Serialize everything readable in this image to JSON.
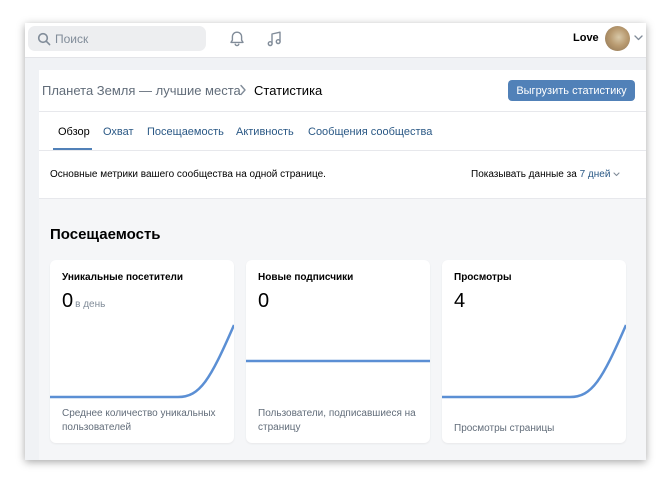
{
  "topbar": {
    "search_placeholder": "Поиск",
    "user_name": "Love"
  },
  "breadcrumb": {
    "community": "Планета Земля — лучшие места",
    "current": "Статистика"
  },
  "export_button": "Выгрузить статистику",
  "tabs": [
    {
      "label": "Обзор",
      "active": true
    },
    {
      "label": "Охват",
      "active": false
    },
    {
      "label": "Посещаемость",
      "active": false
    },
    {
      "label": "Активность",
      "active": false
    },
    {
      "label": "Сообщения сообщества",
      "active": false
    }
  ],
  "info": {
    "description": "Основные метрики вашего сообщества на одной странице.",
    "period_label": "Показывать данные за",
    "period_value": "7 дней"
  },
  "section": {
    "title": "Посещаемость"
  },
  "stat_cards": [
    {
      "title": "Уникальные посетители",
      "value": "0",
      "unit": "в день",
      "description": "Среднее количество уникальных пользователей"
    },
    {
      "title": "Новые подписчики",
      "value": "0",
      "unit": "",
      "description": "Пользователи, подписавшиеся на страницу"
    },
    {
      "title": "Просмотры",
      "value": "4",
      "unit": "",
      "description": "Просмотры страницы"
    }
  ],
  "colors": {
    "accent": "#5181b8",
    "link": "#2a5885",
    "graph_line": "#5b8fd4"
  }
}
